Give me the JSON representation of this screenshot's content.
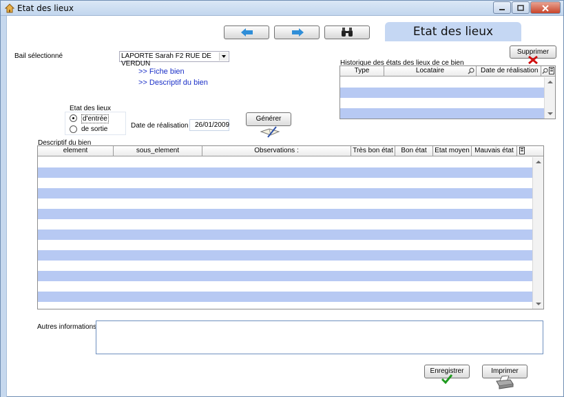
{
  "window": {
    "title": "Etat des lieux",
    "header_tab": "Etat des lieux"
  },
  "bail": {
    "label": "Bail sélectionné",
    "value": "LAPORTE Sarah F2 RUE DE VERDUN"
  },
  "links": {
    "fiche": ">> Fiche bien",
    "descriptif": ">> Descriptif du bien"
  },
  "etat": {
    "group_label": "Etat des lieux",
    "options": [
      "d'entrée",
      "de sortie"
    ],
    "selected": "d'entrée"
  },
  "date": {
    "label": "Date de réalisation",
    "value": "26/01/2009"
  },
  "buttons": {
    "generer": "Générer",
    "supprimer": "Supprimer",
    "enregistrer": "Enregistrer",
    "imprimer": "Imprimer"
  },
  "history": {
    "title": "Historique des états des lieux de ce bien",
    "columns": [
      "Type",
      "Locataire",
      "Date de réalisation"
    ],
    "rows": 4
  },
  "descriptif": {
    "title": "Descriptif du bien",
    "columns": [
      "element",
      "sous_element",
      "Observations :",
      "Très bon état",
      "Bon état",
      "Etat moyen",
      "Mauvais état"
    ],
    "rows": 15
  },
  "autres": {
    "label": "Autres informations",
    "value": ""
  },
  "colors": {
    "row_alt": "#b7c9f3",
    "header_tab": "#c5d7f3",
    "link": "#1a2fc7",
    "delete_x": "#d01010",
    "check": "#1f9a1f"
  }
}
